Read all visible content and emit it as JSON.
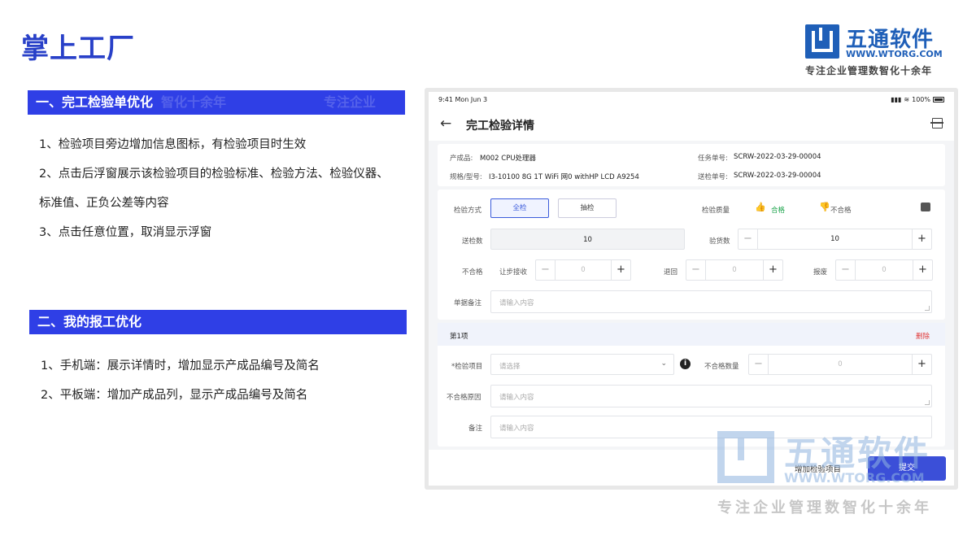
{
  "page": {
    "title": "掌上工厂"
  },
  "logo": {
    "name": "五通软件",
    "url": "WWW.WTORG.COM",
    "slogan": "专注企业管理数智化十余年"
  },
  "section1": {
    "title": "一、完工检验单优化",
    "watermark_a": "智化十余年",
    "watermark_b": "专注企业",
    "lines": [
      "1、检验项目旁边增加信息图标，有检验项目时生效",
      "2、点击后浮窗展示该检验项目的检验标准、检验方法、检验仪器、",
      "标准值、正负公差等内容",
      "3、点击任意位置，取消显示浮窗"
    ]
  },
  "section2": {
    "title": "二、我的报工优化",
    "lines": [
      "1、手机端：展示详情时，增加显示产成品编号及简名",
      "2、平板端：增加产成品列，显示产成品编号及简名"
    ]
  },
  "device": {
    "status": {
      "time": "9:41   Mon Jun 3",
      "battery": "100%"
    },
    "nav_title": "完工检验详情",
    "info": {
      "product_label": "产成品:",
      "product_value": "M002 CPU处理器",
      "spec_label": "规格/型号:",
      "spec_value": "I3-10100 8G 1T WiFi 网0 withHP LCD A9254",
      "task_label": "任务单号:",
      "task_value": "SCRW-2022-03-29-00004",
      "send_label": "送检单号:",
      "send_value": "SCRW-2022-03-29-00004"
    },
    "form": {
      "method_label": "检验方式",
      "method_full": "全检",
      "method_sample": "抽检",
      "quality_label": "检验质量",
      "quality_pass": "合格",
      "quality_fail": "不合格",
      "sent_label": "送检数",
      "sent_value": "10",
      "accept_label": "验货数",
      "accept_value": "10",
      "reject_label": "不合格",
      "concession_label": "让步接收",
      "concession_value": "0",
      "return_label": "退回",
      "return_value": "0",
      "scrap_label": "报废",
      "scrap_value": "0",
      "remark_label": "单据备注",
      "placeholder": "请输入内容"
    },
    "item": {
      "title": "第1项",
      "delete": "删除",
      "check_item_label": "*检验项目",
      "check_item_placeholder": "请选择",
      "defect_qty_label": "不合格数量",
      "defect_qty_value": "0",
      "defect_reason_label": "不合格原因",
      "note_label": "备注",
      "placeholder": "请输入内容"
    },
    "bottom": {
      "add_label": "增加检验项目",
      "submit_label": "提交"
    }
  },
  "colors": {
    "accent": "#2f3fe6",
    "title": "#2840c8",
    "pass": "#1aa34a",
    "delete": "#e03a3a"
  }
}
